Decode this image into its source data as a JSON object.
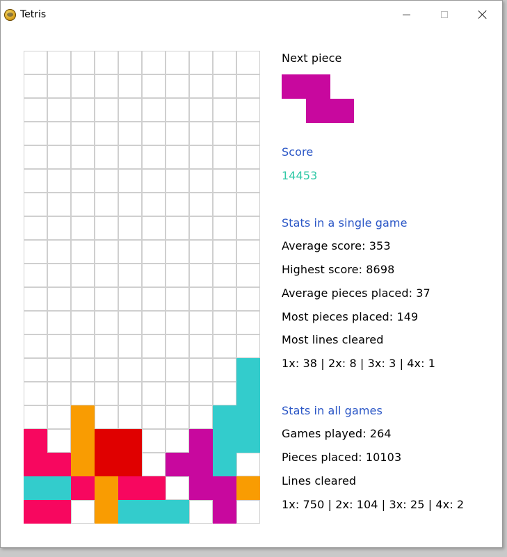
{
  "window": {
    "title": "Tetris"
  },
  "colors": {
    "magenta": "#c8089e",
    "pink": "#f7075f",
    "orange": "#f99c02",
    "red": "#e00000",
    "cyan": "#33cccc",
    "grid_line": "#cfcfcf"
  },
  "board": {
    "cols": 10,
    "rows": 20,
    "filled": [
      {
        "row": 13,
        "col": 9,
        "color": "cyan"
      },
      {
        "row": 14,
        "col": 9,
        "color": "cyan"
      },
      {
        "row": 15,
        "col": 2,
        "color": "orange"
      },
      {
        "row": 15,
        "col": 8,
        "color": "cyan"
      },
      {
        "row": 15,
        "col": 9,
        "color": "cyan"
      },
      {
        "row": 16,
        "col": 0,
        "color": "pink"
      },
      {
        "row": 16,
        "col": 2,
        "color": "orange"
      },
      {
        "row": 16,
        "col": 3,
        "color": "red"
      },
      {
        "row": 16,
        "col": 4,
        "color": "red"
      },
      {
        "row": 16,
        "col": 7,
        "color": "magenta"
      },
      {
        "row": 16,
        "col": 8,
        "color": "cyan"
      },
      {
        "row": 16,
        "col": 9,
        "color": "cyan"
      },
      {
        "row": 17,
        "col": 0,
        "color": "pink"
      },
      {
        "row": 17,
        "col": 1,
        "color": "pink"
      },
      {
        "row": 17,
        "col": 2,
        "color": "orange"
      },
      {
        "row": 17,
        "col": 3,
        "color": "red"
      },
      {
        "row": 17,
        "col": 4,
        "color": "red"
      },
      {
        "row": 17,
        "col": 6,
        "color": "magenta"
      },
      {
        "row": 17,
        "col": 7,
        "color": "magenta"
      },
      {
        "row": 17,
        "col": 8,
        "color": "cyan"
      },
      {
        "row": 18,
        "col": 0,
        "color": "cyan"
      },
      {
        "row": 18,
        "col": 1,
        "color": "cyan"
      },
      {
        "row": 18,
        "col": 2,
        "color": "pink"
      },
      {
        "row": 18,
        "col": 3,
        "color": "orange"
      },
      {
        "row": 18,
        "col": 4,
        "color": "pink"
      },
      {
        "row": 18,
        "col": 5,
        "color": "pink"
      },
      {
        "row": 18,
        "col": 7,
        "color": "magenta"
      },
      {
        "row": 18,
        "col": 8,
        "color": "magenta"
      },
      {
        "row": 18,
        "col": 9,
        "color": "orange"
      },
      {
        "row": 19,
        "col": 0,
        "color": "pink"
      },
      {
        "row": 19,
        "col": 1,
        "color": "pink"
      },
      {
        "row": 19,
        "col": 3,
        "color": "orange"
      },
      {
        "row": 19,
        "col": 4,
        "color": "cyan"
      },
      {
        "row": 19,
        "col": 5,
        "color": "cyan"
      },
      {
        "row": 19,
        "col": 6,
        "color": "cyan"
      },
      {
        "row": 19,
        "col": 8,
        "color": "magenta"
      }
    ]
  },
  "next_piece": {
    "label": "Next piece",
    "shape": "Z",
    "color": "magenta"
  },
  "score": {
    "label": "Score",
    "value": "14453"
  },
  "single_game": {
    "heading": "Stats in a single game",
    "average_score": "Average score: 353",
    "highest_score": "Highest score: 8698",
    "average_pieces": "Average pieces placed: 37",
    "most_pieces": "Most pieces placed: 149",
    "most_lines": "Most lines cleared",
    "lines_breakdown": "1x: 38 | 2x: 8 | 3x: 3 | 4x: 1"
  },
  "all_games": {
    "heading": "Stats in all games",
    "games_played": "Games played: 264",
    "pieces_placed": "Pieces placed: 10103",
    "lines_cleared": "Lines cleared",
    "lines_breakdown": "1x: 750 | 2x: 104 | 3x: 25 | 4x: 2"
  }
}
